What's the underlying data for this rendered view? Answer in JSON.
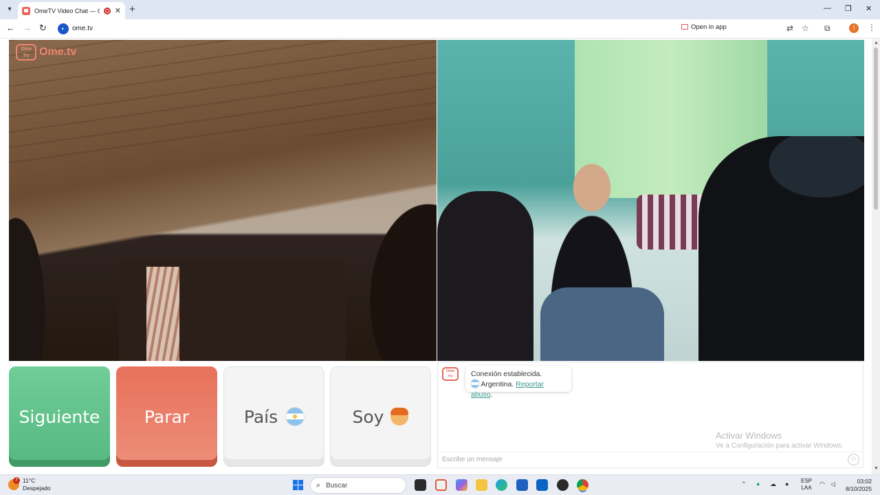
{
  "browser": {
    "tab_title": "OmeTV Video Chat — Ome",
    "tab_close": "✕",
    "new_tab": "+",
    "url": "ome.tv",
    "open_in_app": "Open in app",
    "window_minimize": "—",
    "window_restore": "❐",
    "window_close": "✕",
    "profile_initial": "I"
  },
  "site": {
    "logo_badge": "Ome TV",
    "logo_text": "Ome.tv",
    "buttons": {
      "next": "Siguiente",
      "stop": "Parar",
      "country": "País",
      "gender": "Soy"
    },
    "chat": {
      "logo_badge": "Ome TV",
      "status": "Conexión establecida.",
      "country": "Argentina.",
      "report_link": "Reportar abuso",
      "report_suffix": ".",
      "input_placeholder": "Escribe un mensaje"
    }
  },
  "watermark": {
    "title": "Activar Windows",
    "subtitle": "Ve a Configuración para activar Windows."
  },
  "taskbar": {
    "weather_temp": "11°C",
    "weather_desc": "Despejado",
    "weather_badge": "7",
    "search_label": "Buscar",
    "lang_primary": "ESP",
    "lang_secondary": "LAA",
    "time": "03:02",
    "date": "8/10/2025"
  },
  "colors": {
    "next_button": "#5fc28a",
    "stop_button": "#e8735c",
    "tabbar": "#dfe6f3",
    "link": "#3a9a8e"
  }
}
